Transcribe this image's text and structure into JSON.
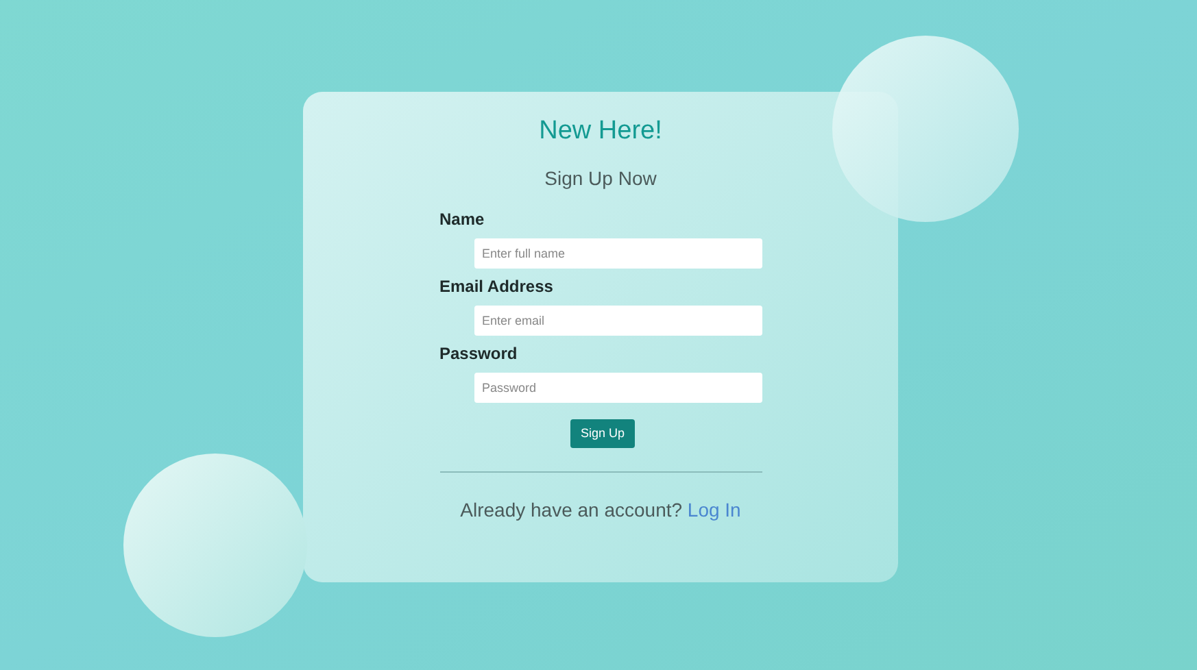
{
  "card": {
    "title": "New Here!",
    "subtitle": "Sign Up Now"
  },
  "fields": [
    {
      "label": "Name",
      "placeholder": "Enter full name"
    },
    {
      "label": "Email Address",
      "placeholder": "Enter email"
    },
    {
      "label": "Password",
      "placeholder": "Password"
    }
  ],
  "submit": "Sign Up",
  "footer": {
    "text": "Already have an account?",
    "link": "Log In"
  }
}
